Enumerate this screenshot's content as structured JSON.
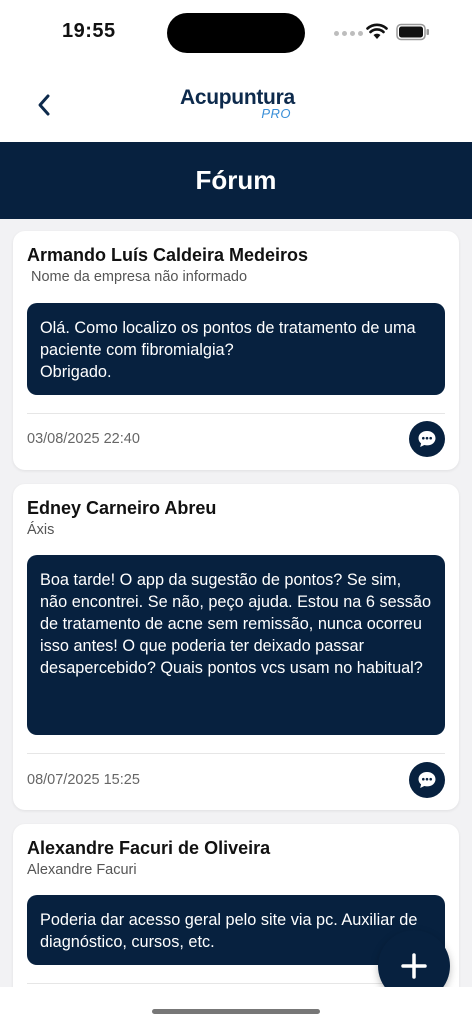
{
  "status_bar": {
    "time": "19:55"
  },
  "header": {
    "logo_main": "Acupuntura",
    "logo_sub": "PRO",
    "brand_color": "#07213f",
    "accent_color": "#3a8fd8"
  },
  "title": "Fórum",
  "posts": [
    {
      "author": "Armando Luís Caldeira Medeiros",
      "company": "Nome da empresa não informado",
      "message": "Olá. Como localizo os pontos de tratamento de uma paciente com fibromialgia?\nObrigado.",
      "date": "03/08/2025 22:40"
    },
    {
      "author": "Edney Carneiro Abreu",
      "company": "Áxis",
      "message": "Boa tarde! O app da sugestão de pontos? Se sim, não encontrei. Se não, peço ajuda. Estou na 6 sessão de tratamento de acne sem remissão, nunca ocorreu isso antes! O que poderia ter deixado passar desapercebido? Quais pontos vcs usam no habitual?",
      "date": "08/07/2025 15:25"
    },
    {
      "author": "Alexandre Facuri de Oliveira",
      "company": "Alexandre Facuri",
      "message": "Poderia dar acesso geral pelo site via pc. Auxiliar de diagnóstico,  cursos,  etc.",
      "date": ""
    }
  ],
  "icons": {
    "back": "chevron-left-icon",
    "comment": "chat-bubble-icon",
    "add": "plus-icon"
  }
}
